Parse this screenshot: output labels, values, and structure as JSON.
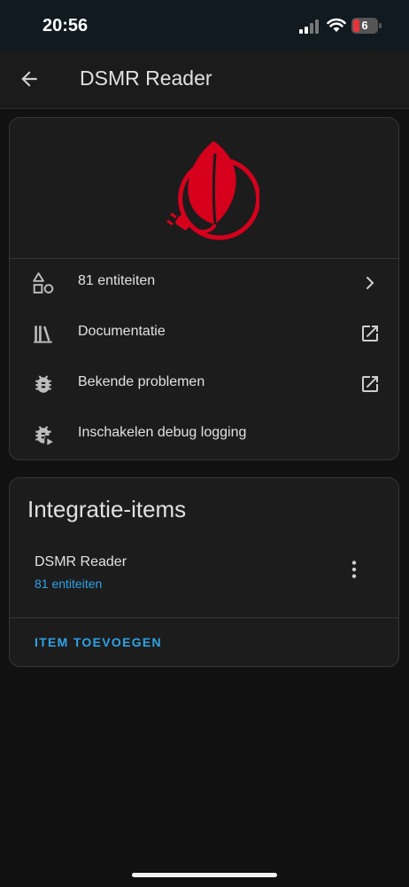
{
  "status_bar": {
    "time": "20:56",
    "battery": "6"
  },
  "header": {
    "title": "DSMR Reader"
  },
  "info_card": {
    "rows": [
      {
        "label": "81 entiteiten",
        "icon": "shapes-icon",
        "trailing": "chevron-right-icon"
      },
      {
        "label": "Documentatie",
        "icon": "library-books-icon",
        "trailing": "open-in-new-icon"
      },
      {
        "label": "Bekende problemen",
        "icon": "bug-icon",
        "trailing": "open-in-new-icon"
      },
      {
        "label": "Inschakelen debug logging",
        "icon": "bug-play-icon",
        "trailing": ""
      }
    ]
  },
  "integration_card": {
    "title": "Integratie-items",
    "item": {
      "name": "DSMR Reader",
      "subtitle": "81 entiteiten"
    },
    "add_button": "ITEM TOEVOEGEN"
  },
  "colors": {
    "accent": "#2ea3e6",
    "logo": "#d6001c",
    "background": "#111111",
    "card": "#1c1c1c"
  }
}
